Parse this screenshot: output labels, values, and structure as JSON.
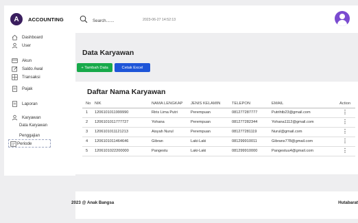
{
  "brand": {
    "initial": "A",
    "name": "ACCOUNTING",
    "color": "#3a1e5e"
  },
  "sidebar": {
    "items": [
      {
        "label": "Dashboard",
        "icon": "home-icon"
      },
      {
        "label": "User",
        "icon": "user-icon"
      },
      {
        "label": "Akun",
        "icon": "credit-card-icon"
      },
      {
        "label": "Saldo Awal",
        "icon": "edit-icon"
      },
      {
        "label": "Transaksi",
        "icon": "grid-icon"
      },
      {
        "label": "Pajak",
        "icon": "document-icon"
      },
      {
        "label": "Laporan",
        "icon": "document-icon"
      },
      {
        "label": "Karyawan",
        "icon": "user-icon"
      }
    ],
    "sub_items": [
      "Data Karyawan",
      "Penggajian"
    ],
    "periode": {
      "label": "Periode",
      "icon": "calendar-icon"
    }
  },
  "topbar": {
    "search_placeholder": "Search.......",
    "datetime": "2023-06-27 14:52:13"
  },
  "page": {
    "title": "Data Karyawan",
    "add_button": "+ Tambah Data",
    "excel_button": "Cetak Excel"
  },
  "table": {
    "title": "Daftar Nama Karyawan",
    "headers": [
      "No",
      "NIK",
      "NAMA LENGKAP",
      "JENIS KELAMIN",
      "TELEPON",
      "EMAIL",
      "Action"
    ],
    "rows": [
      {
        "no": "1",
        "nik": "1206101011999990",
        "nama": "Riris Lima Putri",
        "jk": "Perempuan",
        "telepon": "081277287777",
        "email": "Putrihtb23@gmail.com"
      },
      {
        "no": "2",
        "nik": "1206101011777727",
        "nama": "Yohana",
        "jk": "Perempuan",
        "telepon": "081277282344",
        "email": "Yohana1112@gmail.com"
      },
      {
        "no": "3",
        "nik": "1206101011121213",
        "nama": "Aisyah Nurul",
        "jk": "Perempuan",
        "telepon": "081277281119",
        "email": "Nurul@gmail.com"
      },
      {
        "no": "4",
        "nik": "1206101011464646",
        "nama": "Gibran",
        "jk": "Laki-Laki",
        "telepon": "081299910011",
        "email": "Gibrans778@gmail.com"
      },
      {
        "no": "5",
        "nik": "1206101022200000",
        "nama": "Pangestu",
        "jk": "Laki-Laki",
        "telepon": "081299910000",
        "email": "Pangestuu4@gmail.com"
      }
    ]
  },
  "footer": {
    "left": "2023 @ Anak Bangsa",
    "right": "Hutabarat"
  },
  "colors": {
    "add_button": "#17a94a",
    "excel_button": "#1e55d8",
    "avatar": "#7a4bd0"
  }
}
